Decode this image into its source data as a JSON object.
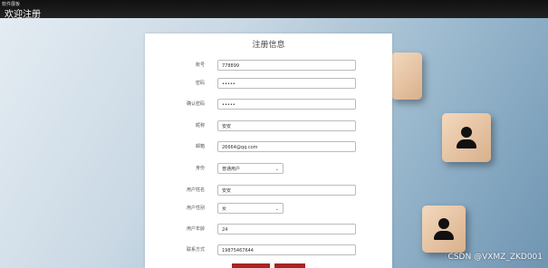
{
  "window": {
    "small_caption": "软件展板",
    "title": "欢迎注册"
  },
  "form": {
    "title": "注册信息",
    "fields": [
      {
        "label": "账号",
        "value": "778899"
      },
      {
        "label": "密码",
        "value": "•••••"
      },
      {
        "label": "确认密码",
        "value": "•••••"
      },
      {
        "label": "昵称",
        "value": "安安"
      },
      {
        "label": "邮箱",
        "value": "26664@qq.com"
      },
      {
        "label": "身份",
        "value": "普通用户"
      },
      {
        "label": "用户姓名",
        "value": "安安"
      },
      {
        "label": "用户性别",
        "value": "女"
      },
      {
        "label": "用户年龄",
        "value": "24"
      },
      {
        "label": "联系方式",
        "value": "19875467644"
      }
    ]
  },
  "watermark": "CSDN @VXMZ_ZKD001",
  "colors": {
    "accent": "#a82424",
    "titlebar": "#111111"
  }
}
